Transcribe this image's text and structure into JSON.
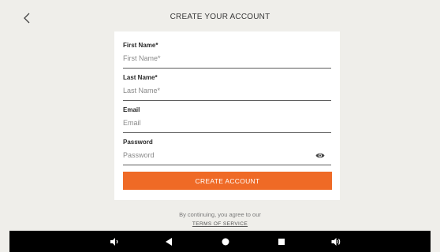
{
  "header": {
    "title": "CREATE YOUR ACCOUNT",
    "back_icon": "chevron-left-icon"
  },
  "form": {
    "fields": [
      {
        "label": "First Name*",
        "placeholder": "First Name*",
        "value": ""
      },
      {
        "label": "Last Name*",
        "placeholder": "Last Name*",
        "value": ""
      },
      {
        "label": "Email",
        "placeholder": "Email",
        "value": ""
      },
      {
        "label": "Password",
        "placeholder": "Password",
        "value": ""
      }
    ],
    "password_toggle_icon": "eye-icon",
    "submit_label": "CREATE ACCOUNT",
    "accent_color": "#ef6a26"
  },
  "footer": {
    "agree_text": "By continuing, you agree to our",
    "terms_link": "TERMS OF SERVICE"
  },
  "navbar": {
    "icons": [
      "volume-down-icon",
      "back-triangle-icon",
      "home-circle-icon",
      "recents-square-icon",
      "volume-up-icon"
    ]
  }
}
